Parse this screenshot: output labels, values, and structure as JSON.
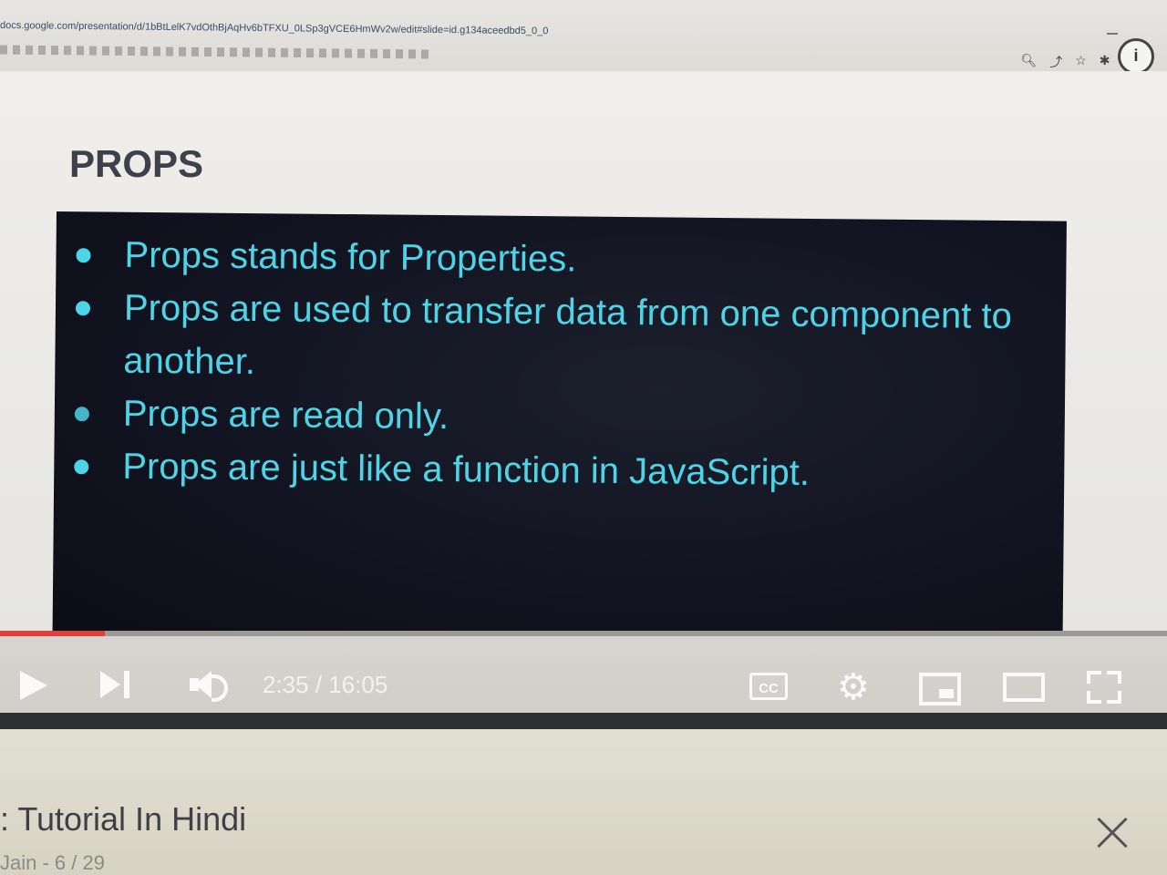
{
  "browser": {
    "url": "docs.google.com/presentation/d/1bBtLelK7vdOthBjAqHv6bTFXU_0LSp3gVCE6HmWv2w/edit#slide=id.g134aceedbd5_0_0",
    "profile_initial": "i",
    "icons": [
      "search-icon",
      "share-icon",
      "star-icon",
      "extensions-icon",
      "reading-list-icon"
    ]
  },
  "slide": {
    "title": "PROPS",
    "bullets": [
      "Props stands for Properties.",
      "Props are used to transfer data from one component to another.",
      "Props are read only.",
      "Props are just like a function in JavaScript."
    ]
  },
  "player": {
    "timecode": "2:35 / 16:05",
    "progress_fraction": 0.09,
    "cc_label": "CC",
    "accent_color": "#e0403a"
  },
  "video": {
    "title": ": Tutorial In Hindi",
    "subtitle": "Jain - 6 / 29"
  }
}
